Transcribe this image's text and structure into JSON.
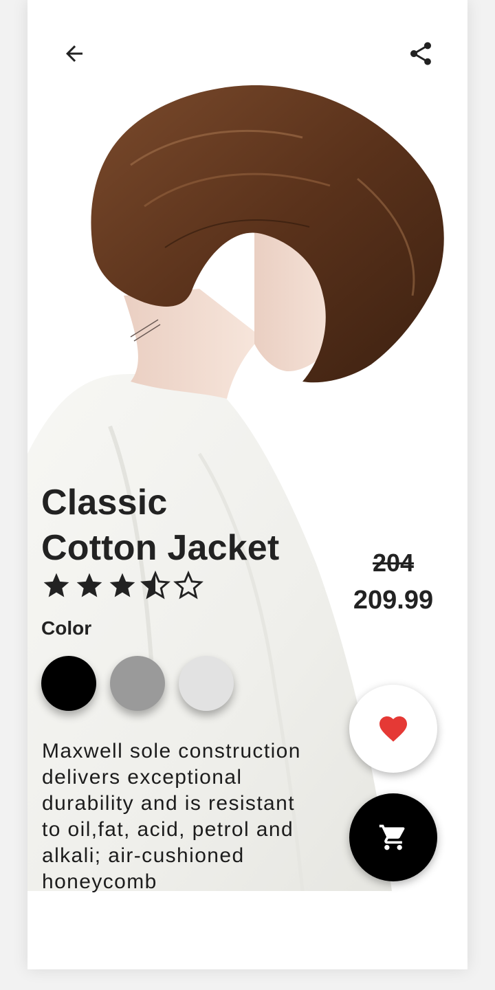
{
  "icons": {
    "back": "arrow-left",
    "share": "share",
    "favorite": "heart",
    "cart": "shopping-cart"
  },
  "product": {
    "title_line1": "Classic",
    "title_line2": "Cotton Jacket",
    "rating": 3.5,
    "rating_max": 5,
    "color_label": "Color",
    "colors": [
      "#000000",
      "#9a9a9a",
      "#e2e2e2"
    ],
    "old_price": "204",
    "price": "209.99",
    "description": "Maxwell sole construction delivers exceptional durability and is resistant to oil,fat, acid, petrol and alkali; air-cushioned honeycomb"
  },
  "theme": {
    "favorite_color": "#e53935",
    "cart_button_color": "#000000",
    "text_color": "#222222"
  }
}
